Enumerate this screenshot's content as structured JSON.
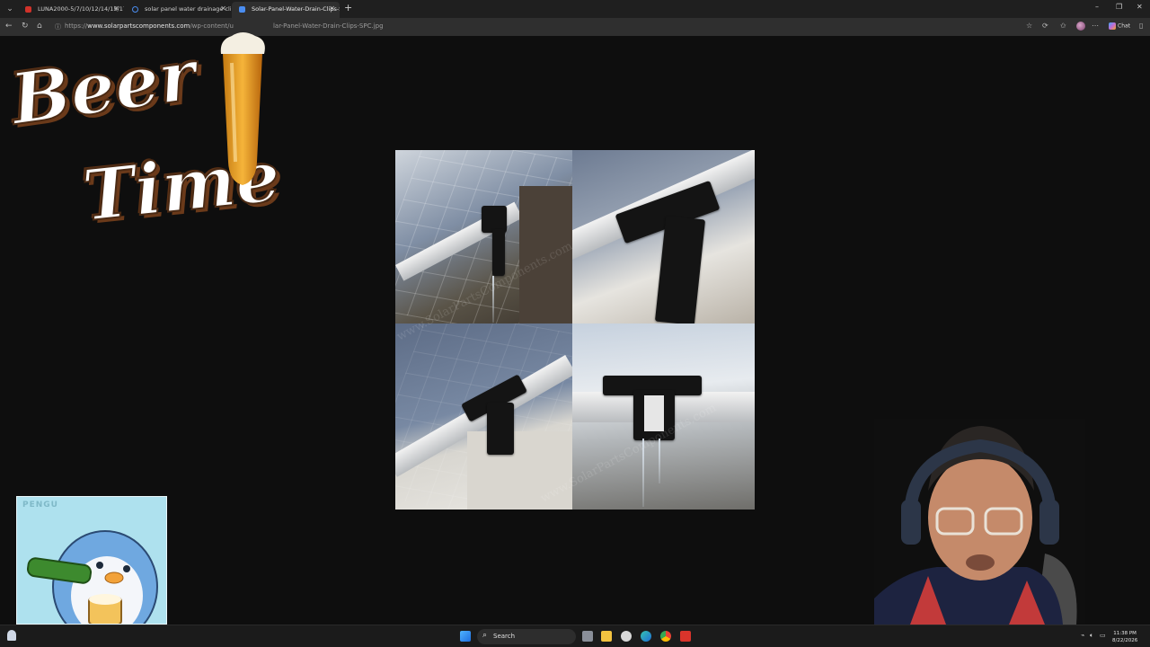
{
  "browser": {
    "tabs": [
      {
        "title": "LUNA2000-5/7/10/12/14/15/17/1",
        "active": false,
        "favicon_color": "#d0322a"
      },
      {
        "title": "solar panel water drainage clips -",
        "active": false,
        "favicon_color": "#4a8df0"
      },
      {
        "title": "Solar-Panel-Water-Drain-Clips-SP",
        "active": true,
        "favicon_color": "#4a8df0"
      }
    ],
    "url_prefix": "https://",
    "url_domain": "www.solarpartscomponents.com",
    "url_path": "/wp-content/u",
    "url_tail": "lar-Panel-Water-Drain-Clips-SPC.jpg",
    "chat_label": "Chat"
  },
  "page": {
    "image_watermark": "www.SolarPartsComponents.com"
  },
  "overlay": {
    "beer_line1": "Beer",
    "beer_line2": "Time",
    "pengu_label": "PENGU"
  },
  "taskbar": {
    "search_label": "Search",
    "time": "11:38 PM",
    "date": "8/22/2026"
  },
  "colors": {
    "accent": "#f5a623",
    "beer_outline": "#4a2a14",
    "penguin_bg": "#aee1ee"
  }
}
